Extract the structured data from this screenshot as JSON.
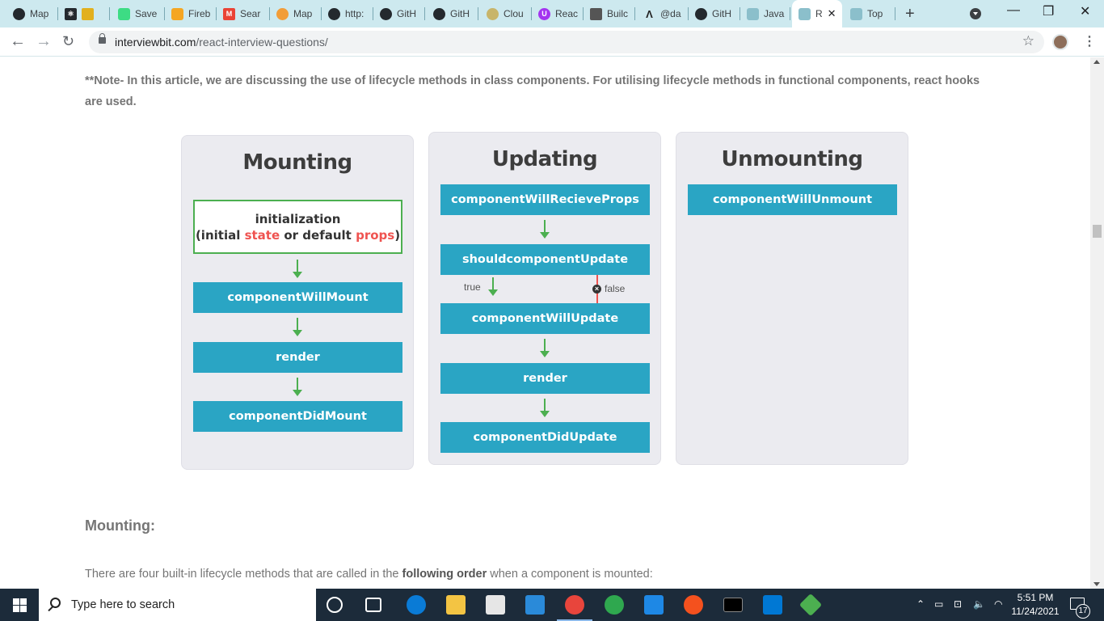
{
  "browser": {
    "tabs": [
      {
        "label": "Map",
        "icon": "github-icon"
      },
      {
        "label": "",
        "icon": "react-icon"
      },
      {
        "label": "Save",
        "icon": "cloud-icon"
      },
      {
        "label": "Fireb",
        "icon": "firebase-icon"
      },
      {
        "label": "Sear",
        "icon": "gmail-icon"
      },
      {
        "label": "Map",
        "icon": "maps-pin-icon"
      },
      {
        "label": "http:",
        "icon": "github-icon"
      },
      {
        "label": "GitH",
        "icon": "github-icon"
      },
      {
        "label": "GitH",
        "icon": "github-icon"
      },
      {
        "label": "Clou",
        "icon": "cloud-leaf-icon"
      },
      {
        "label": "Reac",
        "icon": "udemy-icon"
      },
      {
        "label": "Builc",
        "icon": "build-icon"
      },
      {
        "label": "@da",
        "icon": "caret-icon"
      },
      {
        "label": "GitH",
        "icon": "github-icon"
      },
      {
        "label": "Java",
        "icon": "interviewbit-icon"
      },
      {
        "label": "R",
        "icon": "interviewbit-icon",
        "active": true
      },
      {
        "label": "Top",
        "icon": "interviewbit-icon"
      }
    ],
    "new_tab": "+",
    "url_domain": "interviewbit.com",
    "url_path": "/react-interview-questions/",
    "window_controls": {
      "minimize": "—",
      "restore": "❐",
      "close": "✕"
    }
  },
  "article": {
    "note": "**Note- In this article, we are discussing the use of lifecycle methods in class components. For utilising lifecycle methods in functional components, react hooks are used.",
    "diagram": {
      "mounting": {
        "title": "Mounting",
        "init_line1": "initialization",
        "init_pre": "(initial ",
        "init_state": "state",
        "init_mid": " or default ",
        "init_props": "props",
        "init_post": ")",
        "steps": [
          "componentWillMount",
          "render",
          "componentDidMount"
        ]
      },
      "updating": {
        "title": "Updating",
        "steps": [
          "componentWillRecieveProps",
          "shouldcomponentUpdate",
          "componentWillUpdate",
          "render",
          "componentDidUpdate"
        ],
        "true_label": "true",
        "false_label": "false"
      },
      "unmounting": {
        "title": "Unmounting",
        "steps": [
          "componentWillUnmount"
        ]
      }
    },
    "section_title": "Mounting:",
    "para_pre": "There are four built-in lifecycle methods that are called in the ",
    "para_bold": "following order",
    "para_post": " when a component is mounted:"
  },
  "taskbar": {
    "search_placeholder": "Type here to search",
    "time": "5:51 PM",
    "date": "11/24/2021",
    "notification_count": "17"
  },
  "colors": {
    "accent_box": "#2aa5c4",
    "arrow_green": "#4caf50",
    "false_red": "#ef5350",
    "tab_strip": "#cde9ef"
  }
}
